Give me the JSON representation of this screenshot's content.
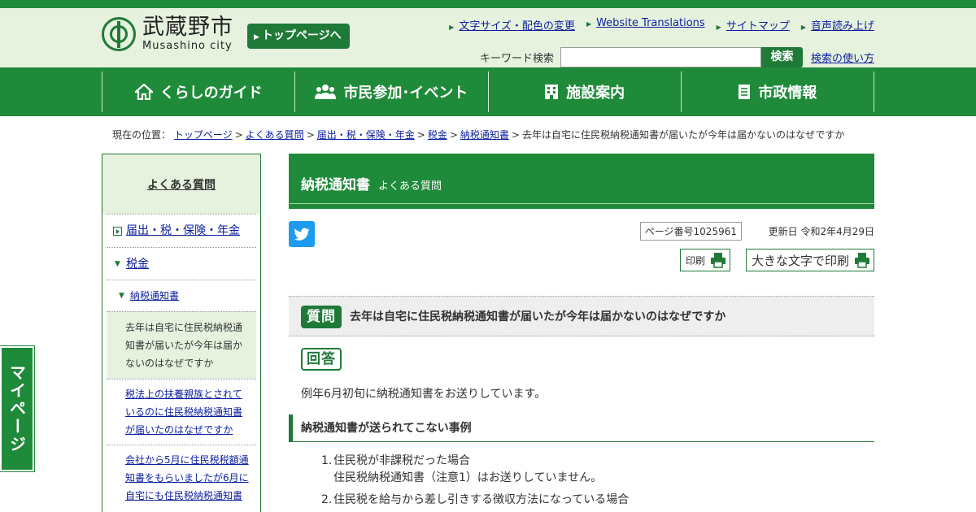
{
  "header": {
    "logo_ja": "武蔵野市",
    "logo_en": "Musashino city",
    "top_button": "トップページへ",
    "util_links": [
      "文字サイズ・配色の変更",
      "Website Translations",
      "サイトマップ",
      "音声読み上げ"
    ],
    "search": {
      "label": "キーワード検索",
      "value": "",
      "button": "検索",
      "help": "検索の使い方"
    }
  },
  "gnav": [
    {
      "label": "くらしのガイド",
      "icon": "house-icon"
    },
    {
      "label": "市民参加･イベント",
      "icon": "people-icon"
    },
    {
      "label": "施設案内",
      "icon": "building-icon"
    },
    {
      "label": "市政情報",
      "icon": "document-icon"
    }
  ],
  "breadcrumb": {
    "prefix": "現在の位置：",
    "links": [
      "トップページ",
      "よくある質問",
      "届出・税・保険・年金",
      "税金",
      "納税通知書"
    ],
    "current": "去年は自宅に住民税納税通知書が届いたが今年は届かないのはなぜですか"
  },
  "side": {
    "heading": "よくある質問",
    "l1": "届出・税・保険・年金",
    "l2": "税金",
    "l3": "納税通知書",
    "current": "去年は自宅に住民税納税通知書が届いたが今年は届かないのはなぜですか",
    "links": [
      "税法上の扶養親族とされているのに住民税納税通知書が届いたのはなぜですか",
      "会社から5月に住民税税額通知書をもらいましたが6月に自宅にも住民税納税通知書"
    ]
  },
  "main": {
    "title": "納税通知書",
    "subtitle": "よくある質問",
    "page_number": "ページ番号1025961",
    "updated": "更新日 令和2年4月29日",
    "print": "印刷",
    "print_large": "大きな文字で印刷",
    "q_badge": "質問",
    "question": "去年は自宅に住民税納税通知書が届いたが今年は届かないのはなぜですか",
    "a_badge": "回答",
    "answer": "例年6月初旬に納税通知書をお送りしています。",
    "section_heading": "納税通知書が送られてこない事例",
    "list": [
      {
        "num": "1.",
        "line1": "住民税が非課税だった場合",
        "line2": "住民税納税通知書（注意1）はお送りしていません。"
      },
      {
        "num": "2.",
        "line1": "住民税を給与から差し引きする徴収方法になっている場合",
        "line2": ""
      }
    ]
  },
  "mypage": "マイページ",
  "colors": {
    "brand_green": "#1f8a3a",
    "light_green": "#e6f2de",
    "link": "#0b1f9e"
  }
}
